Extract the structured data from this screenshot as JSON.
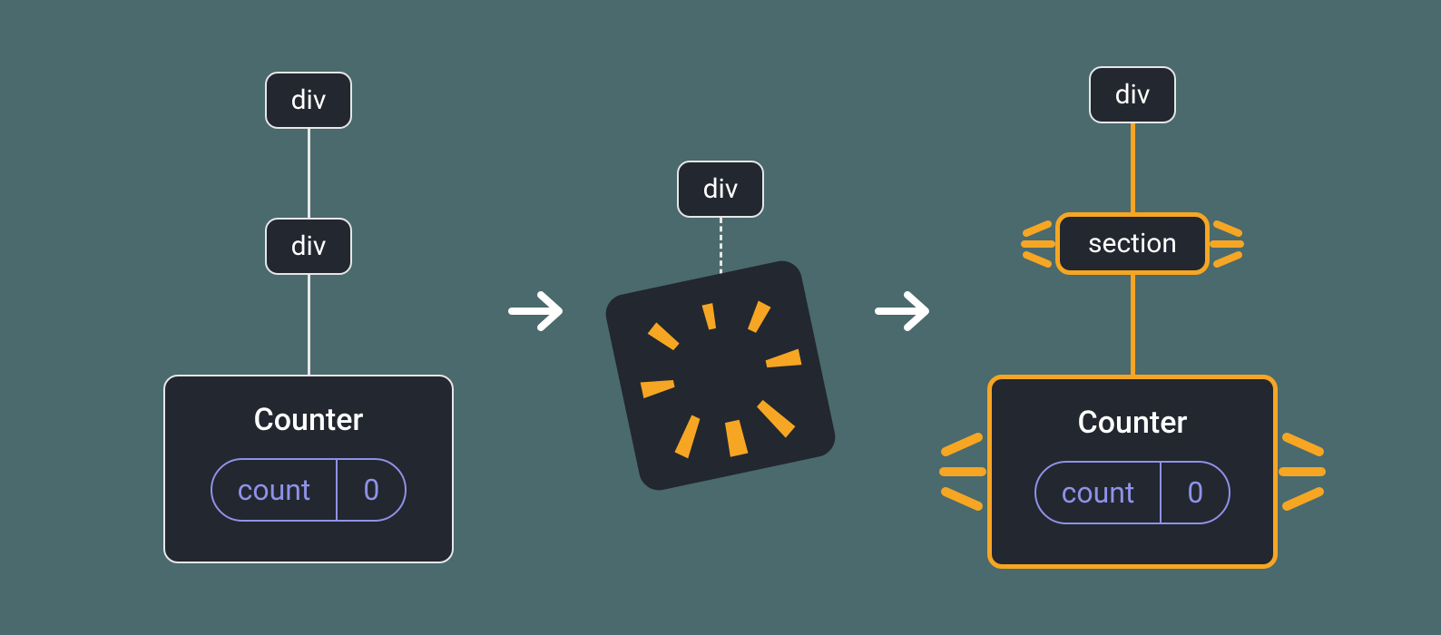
{
  "colors": {
    "bg": "#4a6a6d",
    "node_fill": "#23272f",
    "node_border": "#e6e6e8",
    "highlight": "#f6a623",
    "state_outline": "#8f92e8",
    "white": "#ffffff"
  },
  "tree_before": {
    "root": "div",
    "child": "div",
    "component": {
      "name": "Counter",
      "state_key": "count",
      "state_value": "0"
    }
  },
  "tree_during": {
    "root": "div",
    "explosion_icon": "burst-icon"
  },
  "tree_after": {
    "root": "div",
    "child": "section",
    "component": {
      "name": "Counter",
      "state_key": "count",
      "state_value": "0"
    }
  }
}
